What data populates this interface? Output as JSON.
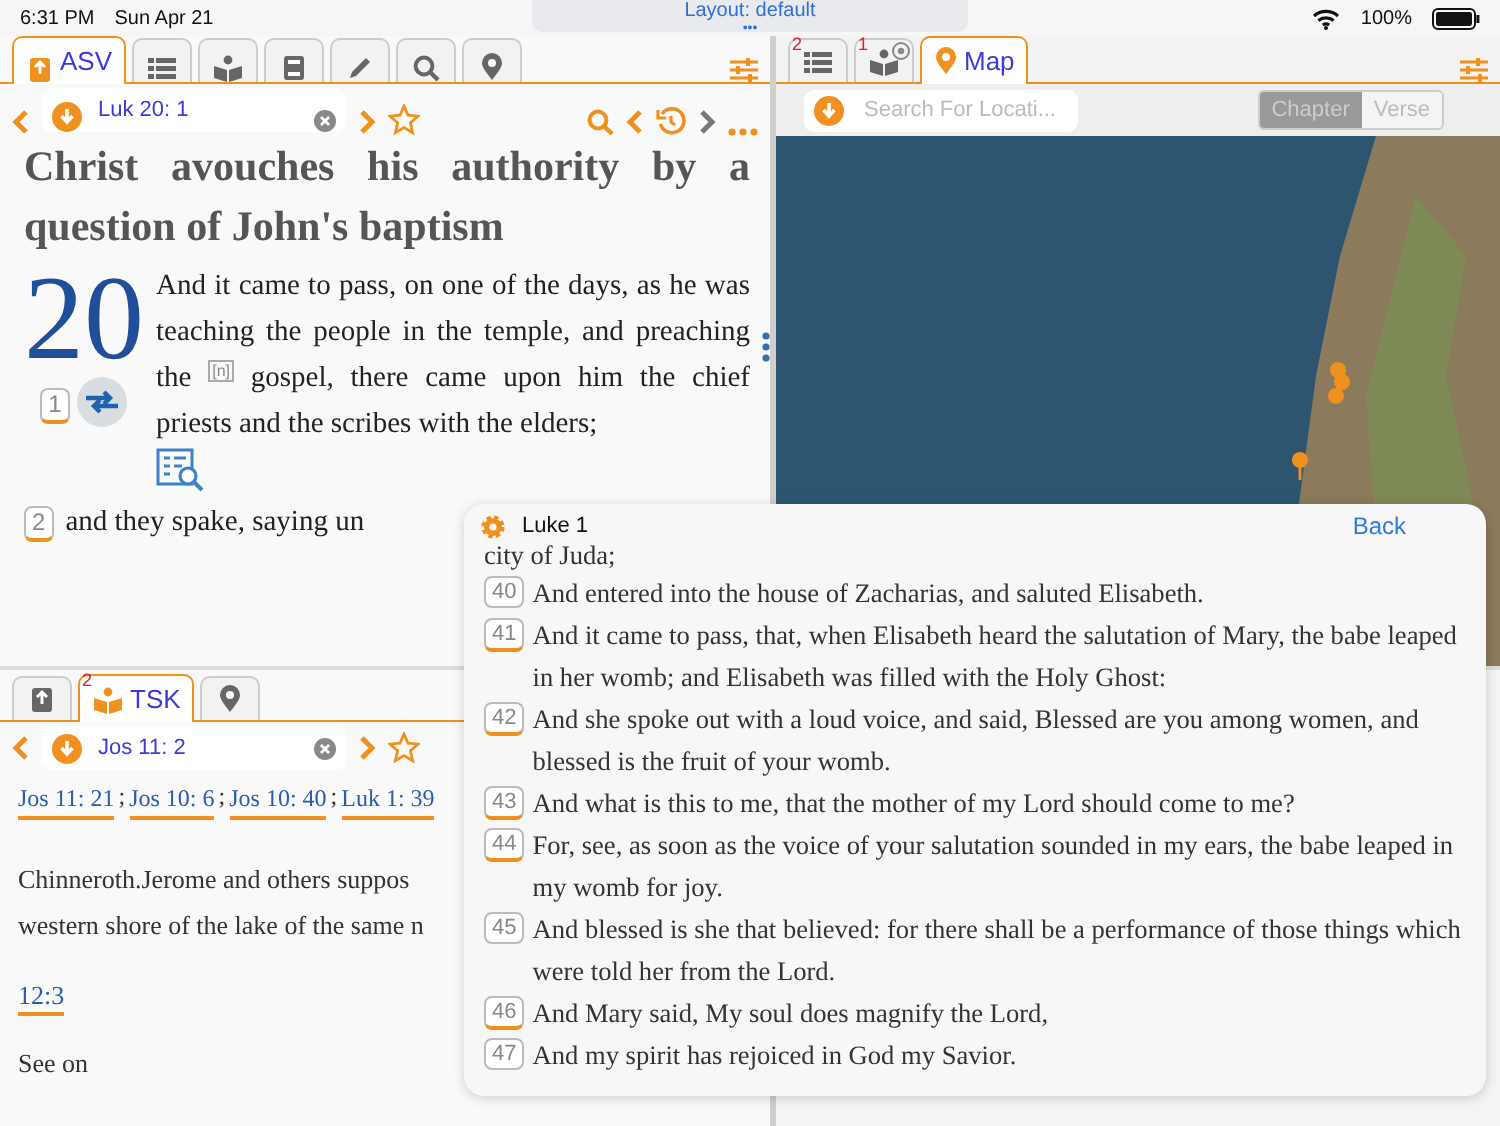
{
  "status_bar": {
    "time": "6:31 PM",
    "date": "Sun Apr 21",
    "battery": "100%"
  },
  "layout_pill": {
    "label": "Layout: default",
    "handle": "•••"
  },
  "bible_pane": {
    "tabs": [
      {
        "kind": "label",
        "label": "ASV",
        "selected": true
      },
      {
        "kind": "icon",
        "selected": false
      },
      {
        "kind": "icon",
        "selected": false
      },
      {
        "kind": "icon",
        "selected": false
      },
      {
        "kind": "icon",
        "selected": false
      },
      {
        "kind": "icon",
        "selected": false
      },
      {
        "kind": "icon",
        "selected": false
      }
    ],
    "reference": "Luk 20: 1",
    "heading": "Christ avouches his authority by a question of John's baptism",
    "chapter_number": "20",
    "verses": [
      {
        "number": "1",
        "marked": true,
        "cross_ref": true,
        "text_before": "And it came to pass, on one of the days, as he was teaching the people in the temple, and preaching the",
        "note_mark": "[n]",
        "text_after": "gospel, there came upon him the chief priests and the scribes with the elders;",
        "notes": true
      },
      {
        "number": "2",
        "marked": true,
        "cross_ref": false,
        "text_before": "and they spake, saying un",
        "notes": false
      }
    ]
  },
  "tsk_pane": {
    "tabs": [
      {
        "kind": "icon",
        "selected": false
      },
      {
        "kind": "label",
        "label": "TSK",
        "badge": "2",
        "selected": true
      },
      {
        "kind": "icon",
        "selected": false
      }
    ],
    "reference": "Jos 11: 2",
    "links": [
      {
        "label": "Jos 11: 21",
        "separator": ";"
      },
      {
        "label": "Jos 10: 6",
        "separator": ";"
      },
      {
        "label": "Jos 10: 40",
        "separator": ";"
      },
      {
        "label": "Luk 1: 39"
      }
    ],
    "lines": [
      "Chinneroth.Jerome and others suppos",
      "western shore of the lake of the same n"
    ],
    "link": "12:3",
    "footer": "See on"
  },
  "map_pane": {
    "tabs": [
      {
        "kind": "icon",
        "badge": "2",
        "closable": false,
        "selected": false
      },
      {
        "kind": "icon",
        "badge": "1",
        "closable": true,
        "selected": false
      },
      {
        "kind": "label",
        "label": "Map",
        "closable": false,
        "selected": true
      }
    ],
    "search": {
      "placeholder": "Search For Locati..."
    },
    "segments": [
      {
        "label": "Chapter",
        "selected": true
      },
      {
        "label": "Verse",
        "selected": false
      }
    ]
  },
  "popup": {
    "title": "Luke 1",
    "back": "Back",
    "lead": "city of Juda;",
    "verses": [
      {
        "number": "40",
        "marked": false,
        "text": "And entered into the house of Zacharias, and saluted Elisabeth."
      },
      {
        "number": "41",
        "marked": true,
        "text": "And it came to pass, that, when Elisabeth heard the salutation of Mary, the babe leaped in her womb; and Elisabeth was filled with the Holy Ghost:"
      },
      {
        "number": "42",
        "marked": true,
        "text": "And she spoke out with a loud voice, and said, Blessed are you among women, and blessed is the fruit of your womb."
      },
      {
        "number": "43",
        "marked": true,
        "text": "And what is this to me, that the mother of my Lord should come to me?"
      },
      {
        "number": "44",
        "marked": true,
        "text": "For, see, as soon as the voice of your salutation sounded in my ears, the babe leaped in my womb for joy."
      },
      {
        "number": "45",
        "marked": false,
        "text": "And blessed is she that believed: for there shall be a performance of those things which were told her from the Lord."
      },
      {
        "number": "46",
        "marked": true,
        "text": "And Mary said, My soul does magnify the Lord,"
      },
      {
        "number": "47",
        "marked": false,
        "text": "And my spirit has rejoiced in God my Savior."
      }
    ]
  }
}
